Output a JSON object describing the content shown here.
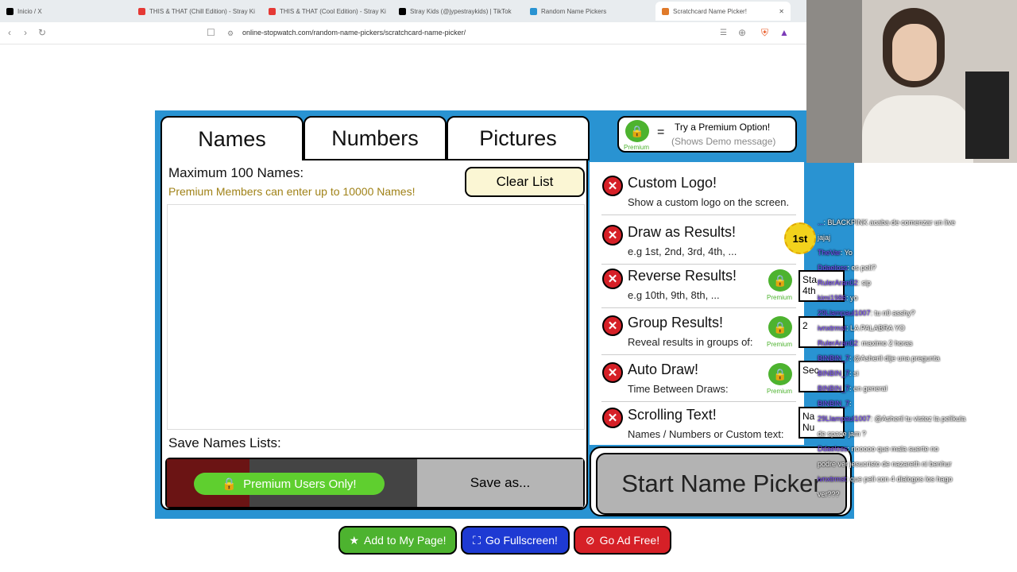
{
  "browser": {
    "tabs": [
      {
        "label": "Inicio / X",
        "fav": "#000"
      },
      {
        "label": "THIS & THAT (Chill Edition) - Stray Ki",
        "fav": "#e53935"
      },
      {
        "label": "THIS & THAT (Cool Edition) - Stray Ki",
        "fav": "#e53935"
      },
      {
        "label": "Stray Kids (@jypestraykids) | TikTok",
        "fav": "#000"
      },
      {
        "label": "Random Name Pickers",
        "fav": "#2993d2"
      },
      {
        "label": "Scratchcard Name Picker!",
        "fav": "#e07a2a"
      }
    ],
    "url": "online-stopwatch.com/random-name-pickers/scratchcard-name-picker/"
  },
  "app": {
    "tabs": [
      "Names",
      "Numbers",
      "Pictures"
    ],
    "premium_option": {
      "line1": "Try a Premium Option!",
      "line2": "(Shows Demo message)",
      "equals": "=",
      "tag": "Premium"
    },
    "max_names": "Maximum 100 Names:",
    "premium_note": "Premium Members can enter  up to 10000 Names!",
    "clear_list": "Clear List",
    "save_lists": "Save Names Lists:",
    "premium_users_only": "Premium Users Only!",
    "save_as": "Save as...",
    "start": "Start Name Picker",
    "features": [
      {
        "title": "Custom Logo!",
        "sub": "Show a custom logo on the screen."
      },
      {
        "title": "Draw as Results!",
        "sub": "e.g 1st, 2nd, 3rd, 4th, ..."
      },
      {
        "title": "Reverse Results!",
        "sub": "e.g 10th, 9th, 8th, ..."
      },
      {
        "title": "Group Results!",
        "sub": "Reveal results in groups of:"
      },
      {
        "title": "Auto Draw!",
        "sub": "Time Between Draws:"
      },
      {
        "title": "Scrolling Text!",
        "sub": "Names / Numbers or Custom text:"
      }
    ],
    "badge_1st": "1st",
    "side_texts": [
      "Sta",
      "4th",
      "2",
      "Sec",
      "Na",
      "Nu"
    ],
    "bottom_buttons": {
      "add": "Add to My Page!",
      "fullscreen": "Go Fullscreen!",
      "adfree": "Go Ad Free!"
    }
  },
  "chat": [
    {
      "name": "...",
      "msg": ": BLACKPINK acaba de comenzar un live"
    },
    {
      "name": "",
      "msg": "jajaj"
    },
    {
      "name": "TheVar",
      "msg": ": Yo"
    },
    {
      "name": "Ddaeloss",
      "msg": ": es peli?"
    },
    {
      "name": "RulerAran02",
      "msg": ": sip"
    },
    {
      "name": "kimi1986",
      "msg": ": yo"
    },
    {
      "name": "29Llampaul1007",
      "msg": ": tu n0 asshy?"
    },
    {
      "name": "ivnxtrmst",
      "msg": ": LA PALABRA YO"
    },
    {
      "name": "RulerAran02",
      "msg": ": maximo 2 horas"
    },
    {
      "name": "BINBIN_7",
      "msg": ": @Asheril dije una pregunta"
    },
    {
      "name": "BINBIN_7",
      "msg": ": si"
    },
    {
      "name": "BINBIN_7",
      "msg": ": en general"
    },
    {
      "name": "BINBIN_7",
      "msg": ":"
    },
    {
      "name": "29Llampaul1007",
      "msg": ": @Asheril tu vistez la pelikula"
    },
    {
      "name": "",
      "msg": "de space jam ?"
    },
    {
      "name": "Ddaeloss",
      "msg": ": nooooo que mala suerte no"
    },
    {
      "name": "",
      "msg": "podre ver jesucristo de nazareth ni benhur"
    },
    {
      "name": "ivnxtrmst",
      "msg": ": que peli con 4 dialogos los hago"
    },
    {
      "name": "",
      "msg": "ver???"
    }
  ]
}
